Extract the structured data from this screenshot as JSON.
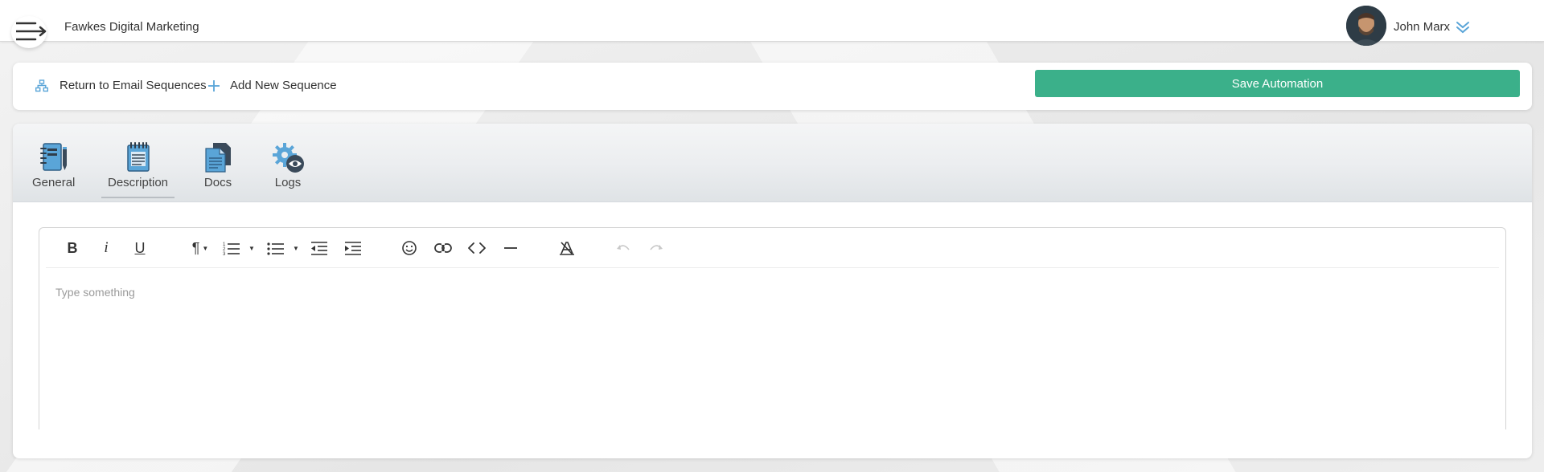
{
  "header": {
    "company_name": "Fawkes Digital Marketing",
    "user_name": "John Marx",
    "menu_icon": "hamburger-arrow-icon",
    "user_menu_icon": "double-chevron-down-icon"
  },
  "actionbar": {
    "return_label": "Return to Email Sequences",
    "return_icon": "sitemap-icon",
    "add_label": "Add New Sequence",
    "add_icon": "plus-icon",
    "save_label": "Save Automation",
    "save_color": "#3bb08a"
  },
  "tabs": [
    {
      "label": "General",
      "icon": "notebook-pen-icon"
    },
    {
      "label": "Description",
      "icon": "notepad-icon",
      "active": true
    },
    {
      "label": "Docs",
      "icon": "documents-icon"
    },
    {
      "label": "Logs",
      "icon": "gear-eye-icon"
    }
  ],
  "editor": {
    "placeholder": "Type something",
    "toolbar": {
      "bold": "B",
      "italic": "i",
      "underline": "U",
      "paragraph": "¶"
    }
  },
  "colors": {
    "accent_blue": "#5aa5d8",
    "icon_dark": "#3a4a5a"
  }
}
